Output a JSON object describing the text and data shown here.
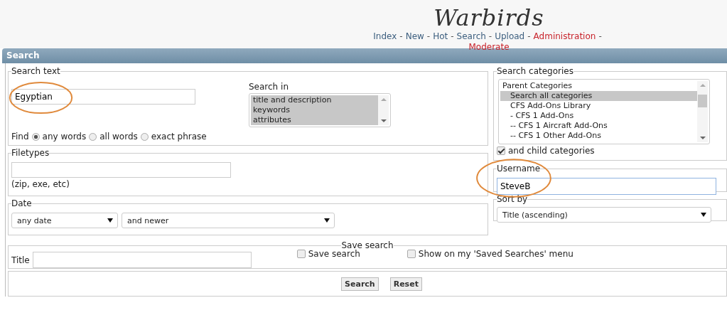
{
  "header": {
    "title": "Warbirds",
    "nav": [
      {
        "label": "Index",
        "kind": "normal"
      },
      {
        "label": "New",
        "kind": "normal"
      },
      {
        "label": "Hot",
        "kind": "normal"
      },
      {
        "label": "Search",
        "kind": "normal"
      },
      {
        "label": "Upload",
        "kind": "normal"
      },
      {
        "label": "Administration",
        "kind": "admin"
      },
      {
        "label": "Moderate",
        "kind": "admin"
      }
    ],
    "separator": "-"
  },
  "panel_title": "Search",
  "search_text": {
    "legend": "Search text",
    "value": "Egyptian",
    "highlighted": true,
    "search_in": {
      "label": "Search in",
      "options": [
        {
          "label": "title and description",
          "selected": true
        },
        {
          "label": "keywords",
          "selected": true
        },
        {
          "label": "attributes",
          "selected": true
        }
      ]
    },
    "find": {
      "label": "Find",
      "options": [
        {
          "label": "any words",
          "selected": true
        },
        {
          "label": "all words",
          "selected": false
        },
        {
          "label": "exact phrase",
          "selected": false
        }
      ]
    }
  },
  "filetypes": {
    "legend": "Filetypes",
    "hint": "(zip, exe, etc)"
  },
  "date": {
    "legend": "Date",
    "range": "any date",
    "direction": "and newer"
  },
  "categories": {
    "legend": "Search categories",
    "options": [
      {
        "label": "Parent Categories",
        "selected": false,
        "kind": "group"
      },
      {
        "label": "Search all categories",
        "selected": true,
        "kind": "item"
      },
      {
        "label": "CFS Add-Ons Library",
        "selected": false,
        "kind": "item"
      },
      {
        "label": "- CFS 1 Add-Ons",
        "selected": false,
        "kind": "item"
      },
      {
        "label": "-- CFS 1 Aircraft Add-Ons",
        "selected": false,
        "kind": "item"
      },
      {
        "label": "-- CFS 1 Other Add-Ons",
        "selected": false,
        "kind": "item"
      }
    ],
    "child_label": "and child categories",
    "child_checked": true
  },
  "username": {
    "legend": "Username",
    "value": "SteveB",
    "highlighted": true
  },
  "sort_by": {
    "legend": "Sort by",
    "value": "Title (ascending)"
  },
  "save_search": {
    "legend": "Save search",
    "title_label": "Title",
    "options": [
      {
        "label": "Save search",
        "checked": false
      },
      {
        "label": "Show on my 'Saved Searches' menu",
        "checked": false
      }
    ]
  },
  "buttons": [
    "Search",
    "Reset"
  ]
}
